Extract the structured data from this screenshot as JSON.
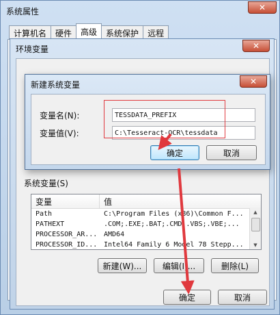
{
  "sysprops": {
    "title": "系统属性",
    "close": "✕",
    "tabs": [
      "计算机名",
      "硬件",
      "高级",
      "系统保护",
      "远程"
    ]
  },
  "envwin": {
    "title": "环境变量",
    "close": "✕",
    "system_vars_label": "系统变量(S)",
    "columns": [
      "变量",
      "值"
    ],
    "rows": [
      {
        "name": "Path",
        "value": "C:\\Program Files (x86)\\Common F..."
      },
      {
        "name": "PATHEXT",
        "value": ".COM;.EXE;.BAT;.CMD;.VBS;.VBE;..."
      },
      {
        "name": "PROCESSOR_AR...",
        "value": "AMD64"
      },
      {
        "name": "PROCESSOR_ID...",
        "value": "Intel64 Family 6 Model 78 Stepp..."
      }
    ],
    "new_btn": "新建(W)...",
    "edit_btn": "编辑(I)...",
    "delete_btn": "删除(L)",
    "ok_btn": "确定",
    "cancel_btn": "取消"
  },
  "newvar": {
    "title": "新建系统变量",
    "close": "✕",
    "name_label": "变量名(N):",
    "value_label": "变量值(V):",
    "name_value": "TESSDATA_PREFIX",
    "value_value": "C:\\Tesseract-OCR\\tessdata",
    "ok_btn": "确定",
    "cancel_btn": "取消"
  },
  "annotation_color": "#e0393e"
}
